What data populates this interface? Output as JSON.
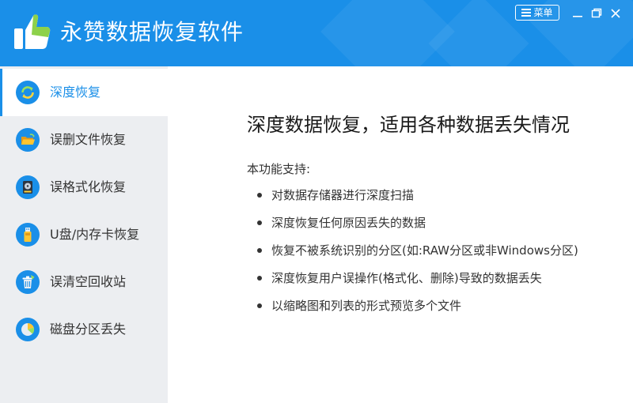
{
  "app": {
    "title": "永赞数据恢复软件"
  },
  "window": {
    "menu_label": "菜单"
  },
  "sidebar": {
    "items": [
      {
        "label": "深度恢复",
        "icon": "refresh-icon",
        "active": true
      },
      {
        "label": "误删文件恢复",
        "icon": "folder-icon",
        "active": false
      },
      {
        "label": "误格式化恢复",
        "icon": "hard-disk-icon",
        "active": false
      },
      {
        "label": "U盘/内存卡恢复",
        "icon": "usb-drive-icon",
        "active": false
      },
      {
        "label": "误清空回收站",
        "icon": "recycle-bin-icon",
        "active": false
      },
      {
        "label": "磁盘分区丢失",
        "icon": "pie-chart-icon",
        "active": false
      }
    ]
  },
  "main": {
    "title": "深度数据恢复，适用各种数据丢失情况",
    "support_label": "本功能支持:",
    "features": [
      "对数据存储器进行深度扫描",
      "深度恢复任何原因丢失的数据",
      "恢复不被系统识别的分区(如:RAW分区或非Windows分区)",
      "深度恢复用户误操作(格式化、删除)导致的数据丢失",
      "以缩略图和列表的形式预览多个文件"
    ]
  },
  "colors": {
    "accent": "#1a8fe8",
    "sidebar_bg": "#eceef1",
    "text": "#333333",
    "icon_bg": "#1a8fe8"
  }
}
